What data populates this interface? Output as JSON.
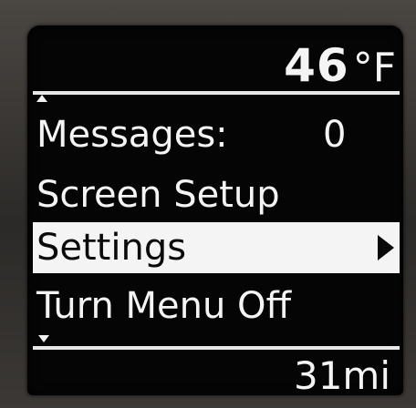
{
  "status": {
    "temperature": "46",
    "temperature_unit": "°F"
  },
  "menu": {
    "items": [
      {
        "label": "Messages:",
        "count": "0"
      },
      {
        "label": "Screen Setup"
      },
      {
        "label": "Settings",
        "selected": true
      },
      {
        "label": "Turn Menu Off"
      }
    ]
  },
  "footer": {
    "distance": "31mi"
  },
  "icons": {
    "scroll_up": "scroll-up-arrow-icon",
    "scroll_down": "scroll-down-arrow-icon",
    "submenu": "chevron-right-icon"
  },
  "colors": {
    "screen_background": "#050505",
    "text": "#f4f4f4",
    "highlight_background": "#f4f4f4",
    "highlight_text": "#0a0a0a"
  }
}
